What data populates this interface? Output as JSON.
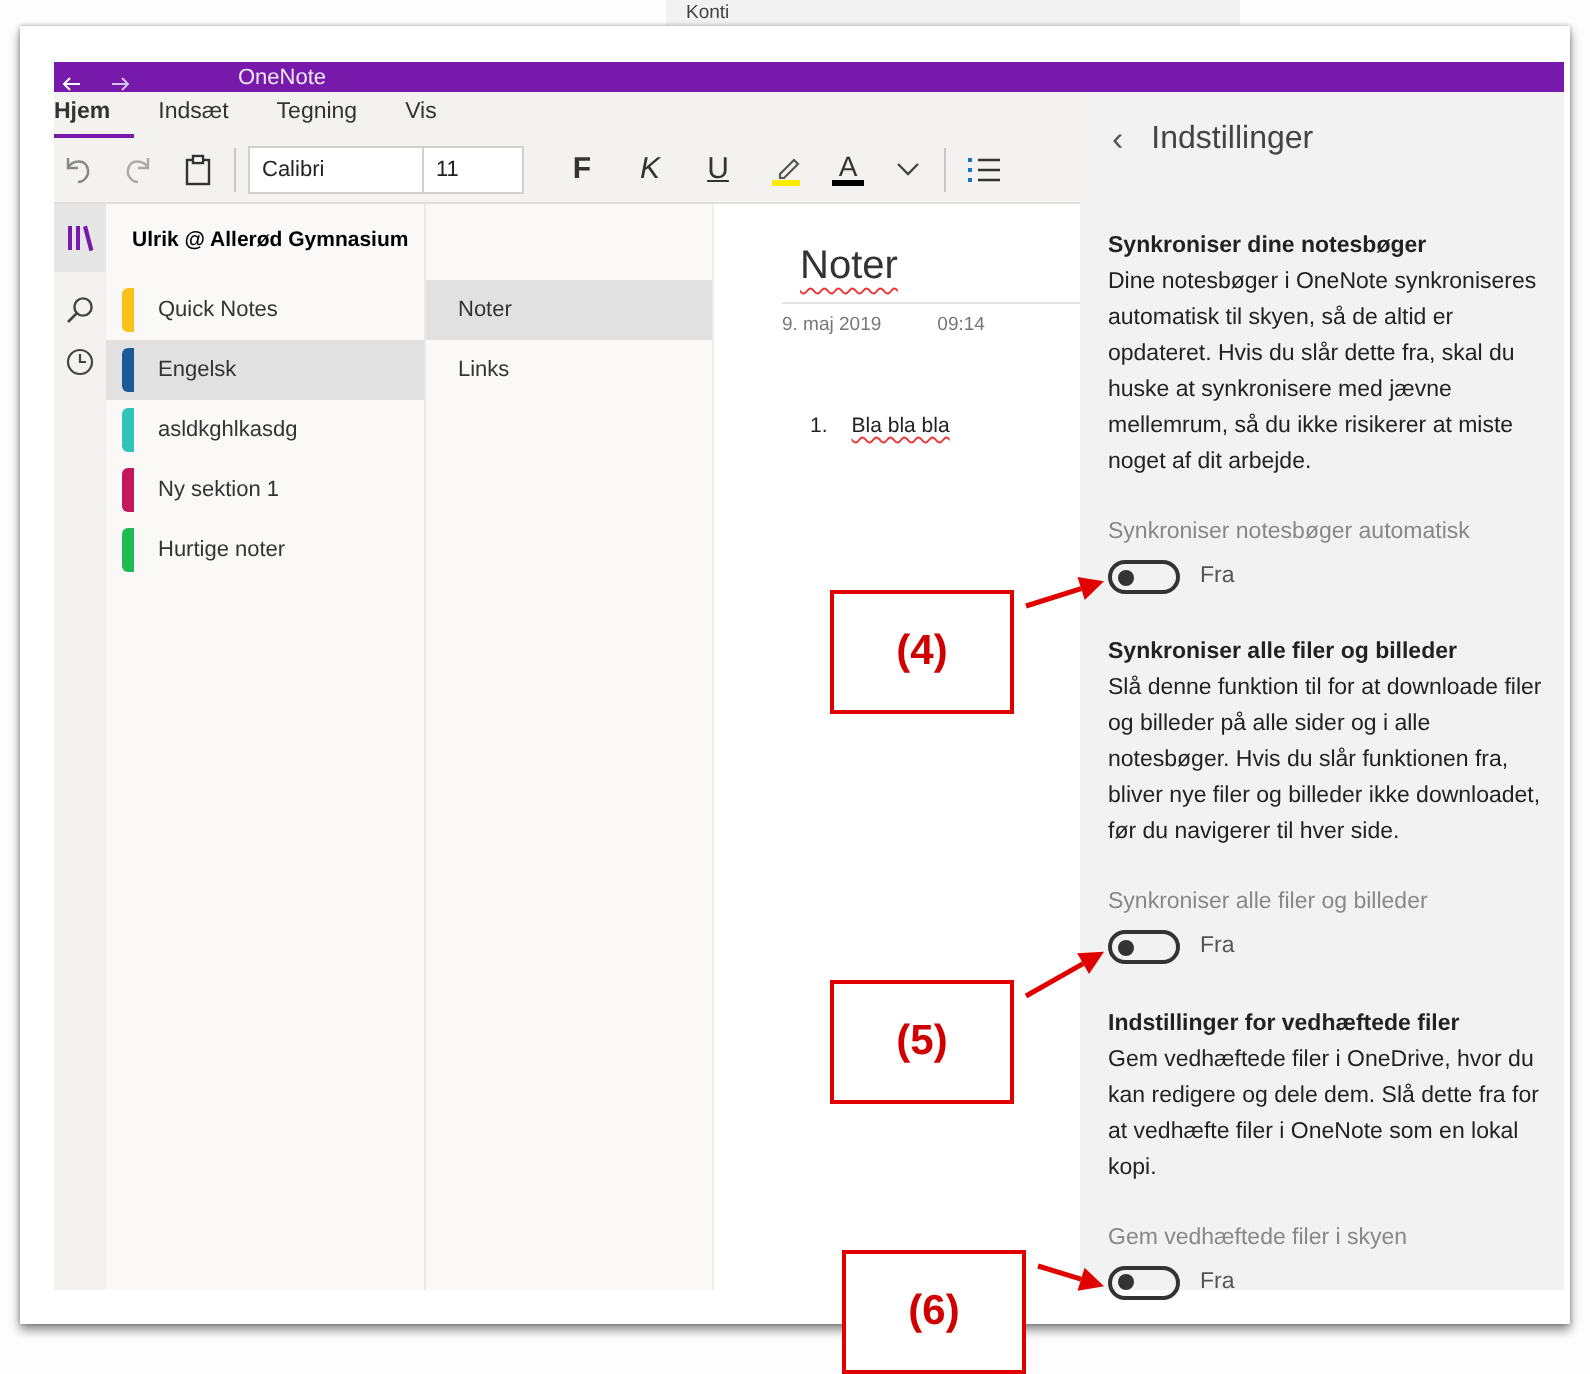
{
  "background": {
    "text": "Konti"
  },
  "window": {
    "title": "OneNote"
  },
  "ribbon": {
    "tabs": [
      {
        "label": "Hjem",
        "selected": true
      },
      {
        "label": "Indsæt",
        "selected": false
      },
      {
        "label": "Tegning",
        "selected": false
      },
      {
        "label": "Vis",
        "selected": false
      }
    ],
    "font": "Calibri",
    "size": "11",
    "format_buttons": [
      {
        "label": "F",
        "kind": "bold"
      },
      {
        "label": "K",
        "kind": "italic"
      },
      {
        "label": "U",
        "kind": "underline"
      }
    ],
    "font_color_label": "A"
  },
  "notebook": {
    "name": "Ulrik @ Allerød Gymnasium",
    "sections": [
      {
        "name": "Quick Notes",
        "color": "#f8c21a",
        "selected": false
      },
      {
        "name": "Engelsk",
        "color": "#1c5a96",
        "selected": true
      },
      {
        "name": "asldkghlkasdg",
        "color": "#2ec4b6",
        "selected": false
      },
      {
        "name": "Ny sektion 1",
        "color": "#c2185b",
        "selected": false
      },
      {
        "name": "Hurtige noter",
        "color": "#1db954",
        "selected": false
      }
    ]
  },
  "pages": [
    {
      "title": "Noter",
      "selected": true
    },
    {
      "title": "Links",
      "selected": false
    }
  ],
  "page": {
    "title": "Noter",
    "date": "9. maj 2019",
    "time": "09:14",
    "list": [
      {
        "number": "1.",
        "text": "Bla bla bla"
      }
    ]
  },
  "settings": {
    "back": "‹",
    "title": "Indstillinger",
    "groups": [
      {
        "heading": "Synkroniser dine notesbøger",
        "description": "Dine notesbøger i OneNote synkroniseres automatisk til skyen, så de altid er opdateret. Hvis du slår dette fra, skal du huske at synkronisere med jævne mellemrum, så du ikke risikerer at miste noget af dit arbejde.",
        "toggle_label": "Synkroniser notesbøger automatisk",
        "on": false,
        "state_text": "Fra"
      },
      {
        "heading": "Synkroniser alle filer og billeder",
        "description": "Slå denne funktion til for at downloade filer og billeder på alle sider og i alle notesbøger. Hvis du slår funktionen fra, bliver nye filer og billeder ikke downloadet, før du navigerer til hver side.",
        "toggle_label": "Synkroniser alle filer og billeder",
        "on": false,
        "state_text": "Fra"
      },
      {
        "heading": "Indstillinger for vedhæftede filer",
        "description": "Gem vedhæftede filer i OneDrive, hvor du kan redigere og dele dem. Slå dette fra for at vedhæfte filer i OneNote som en lokal kopi.",
        "toggle_label": "Gem vedhæftede filer i skyen",
        "on": false,
        "state_text": "Fra"
      }
    ]
  },
  "callouts": [
    {
      "label": "(4)"
    },
    {
      "label": "(5)"
    },
    {
      "label": "(6)"
    }
  ]
}
